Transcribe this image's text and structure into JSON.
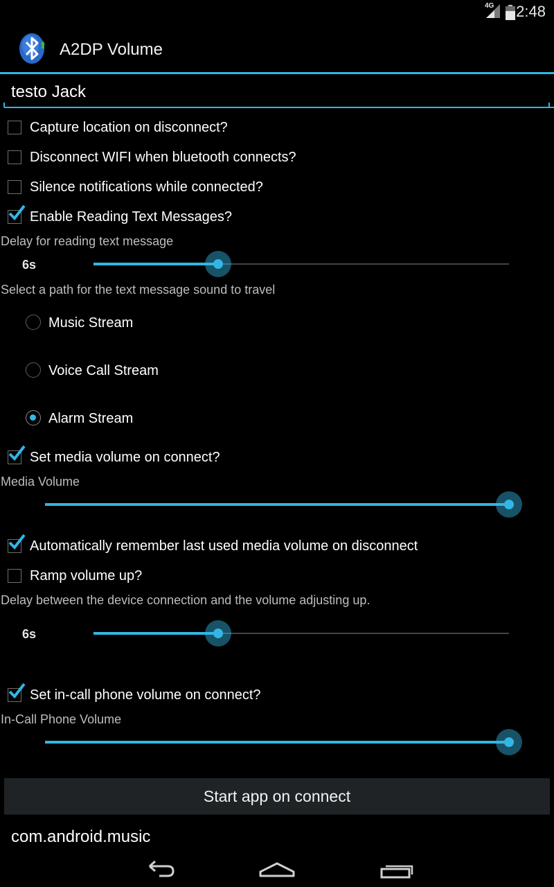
{
  "status_bar": {
    "network": "4G",
    "time": "2:48"
  },
  "app": {
    "title": "A2DP Volume",
    "icon": "bluetooth-icon"
  },
  "device_name": {
    "value": "testo Jack"
  },
  "options": {
    "capture_location": {
      "label": "Capture location on disconnect?",
      "checked": false
    },
    "disconnect_wifi": {
      "label": "Disconnect WIFI when bluetooth connects?",
      "checked": false
    },
    "silence_notifications": {
      "label": "Silence notifications while connected?",
      "checked": false
    },
    "read_text_messages": {
      "label": "Enable Reading Text Messages?",
      "checked": true
    }
  },
  "text_delay": {
    "caption": "Delay for reading text message",
    "value_label": "6s",
    "level": 0.3
  },
  "sound_path": {
    "caption": "Select a path for the text message sound to travel",
    "options": [
      {
        "label": "Music Stream",
        "selected": false
      },
      {
        "label": "Voice Call Stream",
        "selected": false
      },
      {
        "label": "Alarm Stream",
        "selected": true
      }
    ]
  },
  "media_volume": {
    "set_label": "Set media volume on connect?",
    "set_checked": true,
    "caption": "Media Volume",
    "level": 1.0
  },
  "remember_volume": {
    "label": "Automatically remember last used media volume on disconnect",
    "checked": true
  },
  "ramp_volume": {
    "label": "Ramp volume up?",
    "checked": false
  },
  "ramp_delay": {
    "caption": "Delay between the device connection and the volume adjusting up.",
    "value_label": "6s",
    "level": 0.3
  },
  "incall_volume": {
    "set_label": "Set in-call phone volume on connect?",
    "set_checked": true,
    "caption": "In-Call Phone Volume",
    "level": 1.0
  },
  "start_app": {
    "button_label": "Start app on connect",
    "package": "com.android.music"
  },
  "navigation": {
    "back_icon": "back-icon",
    "home_icon": "home-icon",
    "recents_icon": "recents-icon"
  },
  "colors": {
    "accent": "#33b5e5",
    "background": "#000000"
  }
}
